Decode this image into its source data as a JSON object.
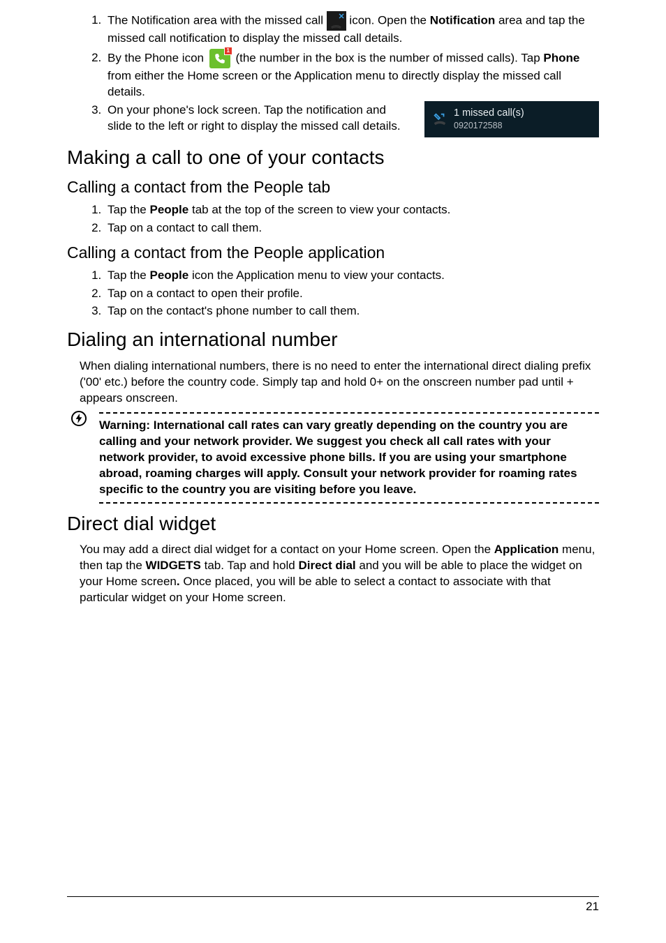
{
  "list1": {
    "i1a": "The Notification area with the missed call ",
    "i1b": " icon. Open the ",
    "i1b_bold": "Notification",
    "i1c": " area and tap the missed call notification to display the missed call details.",
    "i2a": "By the Phone icon ",
    "i2b": " (the number in the box is the number of missed calls). Tap ",
    "i2b_bold": "Phone",
    "i2c": " from either the Home screen or the Application menu to directly display the missed call details.",
    "i3": "On your phone's lock screen. Tap the notification and slide to the left or right to display the missed call details."
  },
  "notif": {
    "line1": "1 missed call(s)",
    "line2": "0920172588"
  },
  "h_making": "Making a call to one of your contacts",
  "h_people_tab": "Calling a contact from the People tab",
  "list2": {
    "i1a": "Tap the ",
    "i1b_bold": "People",
    "i1c": " tab at the top of the screen to view your contacts.",
    "i2": "Tap on a contact to call them."
  },
  "h_people_app": "Calling a contact from the People application",
  "list3": {
    "i1a": "Tap the ",
    "i1b_bold": "People",
    "i1c": " icon the Application menu to view your contacts.",
    "i2": "Tap on a contact to open their profile.",
    "i3": "Tap on the contact's phone number to call them."
  },
  "h_dialing": "Dialing an international number",
  "dialing_body": "When dialing international numbers, there is no need to enter the international direct dialing prefix ('00' etc.) before the country code. Simply tap and hold 0+ on the onscreen number pad until + appears onscreen.",
  "warning": "Warning: International call rates can vary greatly depending on the country you are calling and your network provider. We suggest you check all call rates with your network provider, to avoid excessive phone bills. If you are using your smartphone abroad, roaming charges will apply. Consult your network provider for roaming rates specific to the country you are visiting before you leave.",
  "h_direct": "Direct dial widget",
  "direct_body": {
    "a": "You may add a direct dial widget for a contact on your Home screen. Open the ",
    "b1": "Application",
    "c": " menu, then tap the ",
    "b2": "WIDGETS",
    "d": " tab. Tap and hold ",
    "b3": "Direct dial",
    "e": " and you will be able to place the widget on your Home screen",
    "b4": ".",
    "f": " Once placed, you will be able to select a contact to associate with that particular widget on your Home screen."
  },
  "page_number": "21"
}
